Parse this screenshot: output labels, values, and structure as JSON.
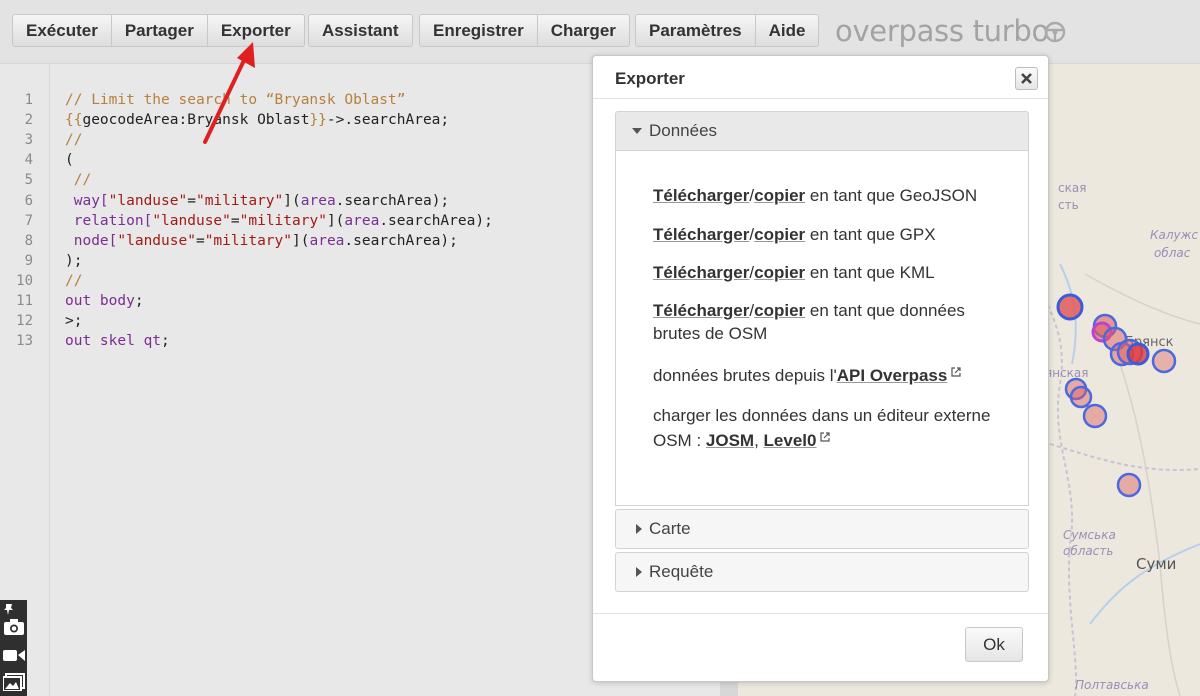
{
  "toolbar": {
    "run": "Exécuter",
    "share": "Partager",
    "export": "Exporter",
    "wizard": "Assistant",
    "save": "Enregistrer",
    "load": "Charger",
    "settings": "Paramètres",
    "help": "Aide",
    "brand": "overpass turbo"
  },
  "editor": {
    "line_numbers": [
      "1",
      "2",
      "3",
      "4",
      "5",
      "6",
      "7",
      "8",
      "9",
      "10",
      "11",
      "12",
      "13"
    ],
    "lines": [
      [
        {
          "t": "// Limit the search to “Bryansk Oblast”",
          "c": "c-cmt"
        }
      ],
      [
        {
          "t": "{{",
          "c": "c-tpl"
        },
        {
          "t": "geocodeArea:Bryansk Oblast",
          "c": ""
        },
        {
          "t": "}}",
          "c": "c-tpl"
        },
        {
          "t": "->.searchArea;",
          "c": ""
        }
      ],
      [
        {
          "t": "//",
          "c": "c-cmt"
        }
      ],
      [
        {
          "t": "(",
          "c": ""
        }
      ],
      [
        {
          "t": " //",
          "c": "c-cmt"
        }
      ],
      [
        {
          "t": " way[",
          "c": "c-kw"
        },
        {
          "t": "\"landuse\"",
          "c": "c-str"
        },
        {
          "t": "=",
          "c": ""
        },
        {
          "t": "\"military\"",
          "c": "c-str"
        },
        {
          "t": "](",
          "c": ""
        },
        {
          "t": "area",
          "c": "c-var"
        },
        {
          "t": ".searchArea);",
          "c": ""
        }
      ],
      [
        {
          "t": " relation[",
          "c": "c-kw"
        },
        {
          "t": "\"landuse\"",
          "c": "c-str"
        },
        {
          "t": "=",
          "c": ""
        },
        {
          "t": "\"military\"",
          "c": "c-str"
        },
        {
          "t": "](",
          "c": ""
        },
        {
          "t": "area",
          "c": "c-var"
        },
        {
          "t": ".searchArea);",
          "c": ""
        }
      ],
      [
        {
          "t": " node[",
          "c": "c-kw"
        },
        {
          "t": "\"landuse\"",
          "c": "c-str"
        },
        {
          "t": "=",
          "c": ""
        },
        {
          "t": "\"military\"",
          "c": "c-str"
        },
        {
          "t": "](",
          "c": ""
        },
        {
          "t": "area",
          "c": "c-var"
        },
        {
          "t": ".searchArea);",
          "c": ""
        }
      ],
      [
        {
          "t": ");",
          "c": ""
        }
      ],
      [
        {
          "t": "//",
          "c": "c-cmt"
        }
      ],
      [
        {
          "t": "out body",
          "c": "c-kw"
        },
        {
          "t": ";",
          "c": ""
        }
      ],
      [
        {
          "t": ">;",
          "c": ""
        }
      ],
      [
        {
          "t": "out skel qt",
          "c": "c-kw"
        },
        {
          "t": ";",
          "c": ""
        }
      ]
    ]
  },
  "map": {
    "labels": {
      "region1": "ская",
      "region2": "сть",
      "kaluga1": "Калужс",
      "kaluga2": "облас",
      "bryansk": "Брянск",
      "yanskaya": "янская",
      "sumy_oblast1": "Сумська",
      "sumy_oblast2": "область",
      "sumy": "Суми",
      "poltava": "Полтавська"
    }
  },
  "dialog": {
    "title": "Exporter",
    "data_section": "Données",
    "download": "Télécharger",
    "slash": "/",
    "copy": "copier",
    "as_geojson": " en tant que GeoJSON",
    "as_gpx": " en tant que GPX",
    "as_kml": " en tant que KML",
    "as_raw": " en tant que données brutes de OSM",
    "raw_from": "données brutes depuis l'",
    "api_overpass": "API Overpass",
    "load_editor": "charger les données dans un éditeur externe OSM : ",
    "josm": "JOSM",
    "comma": ", ",
    "level0": "Level0",
    "map_section": "Carte",
    "query_section": "Requête",
    "ok": "Ok"
  },
  "colors": {
    "arrow": "#e02020",
    "marker_fill": "#e06060",
    "marker_stroke": "#3b5bdb"
  }
}
